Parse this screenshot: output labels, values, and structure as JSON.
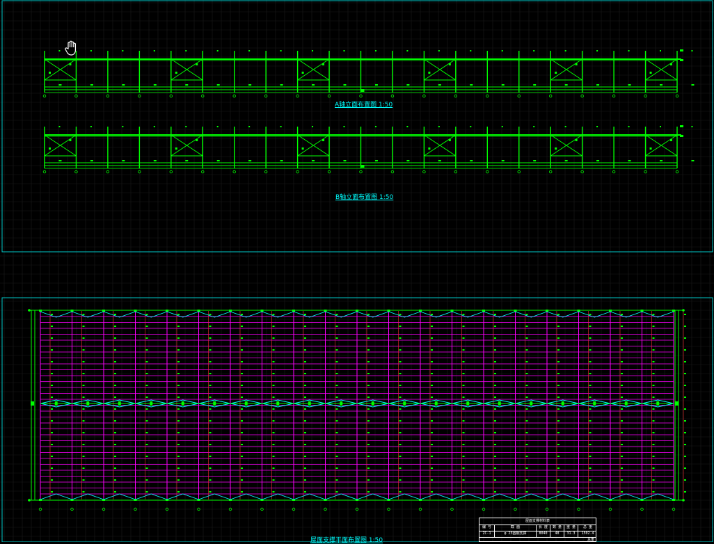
{
  "drawing": {
    "panels": [
      {
        "id": "elevation-panel",
        "title": "A轴立面布置图 1:50"
      },
      {
        "id": "elevation-panel-b",
        "title": "B轴立面布置图 1:50"
      },
      {
        "id": "roof-plan-panel",
        "title": "屋面支撑平面布置图 1:50"
      }
    ],
    "legend_table": {
      "title": "屋面支撑材料表",
      "headers": [
        "编 号",
        "截 面",
        "长 度",
        "数 量",
        "重 量",
        "总 重"
      ],
      "rows": [
        [
          "ZC-1",
          "φ 25圆钢支撑",
          "8040",
          "48",
          "31.3",
          "1502.4"
        ]
      ],
      "note": "总重"
    },
    "colors": {
      "background": "#000000",
      "grid": "#1a1a1a",
      "frame": "#00ffff",
      "steel": "#00ff00",
      "purlin": "#ff00ff",
      "rafter": "#ff3030",
      "text": "#00ffff"
    },
    "icons": {
      "cursor": "hand-pan-icon"
    }
  }
}
